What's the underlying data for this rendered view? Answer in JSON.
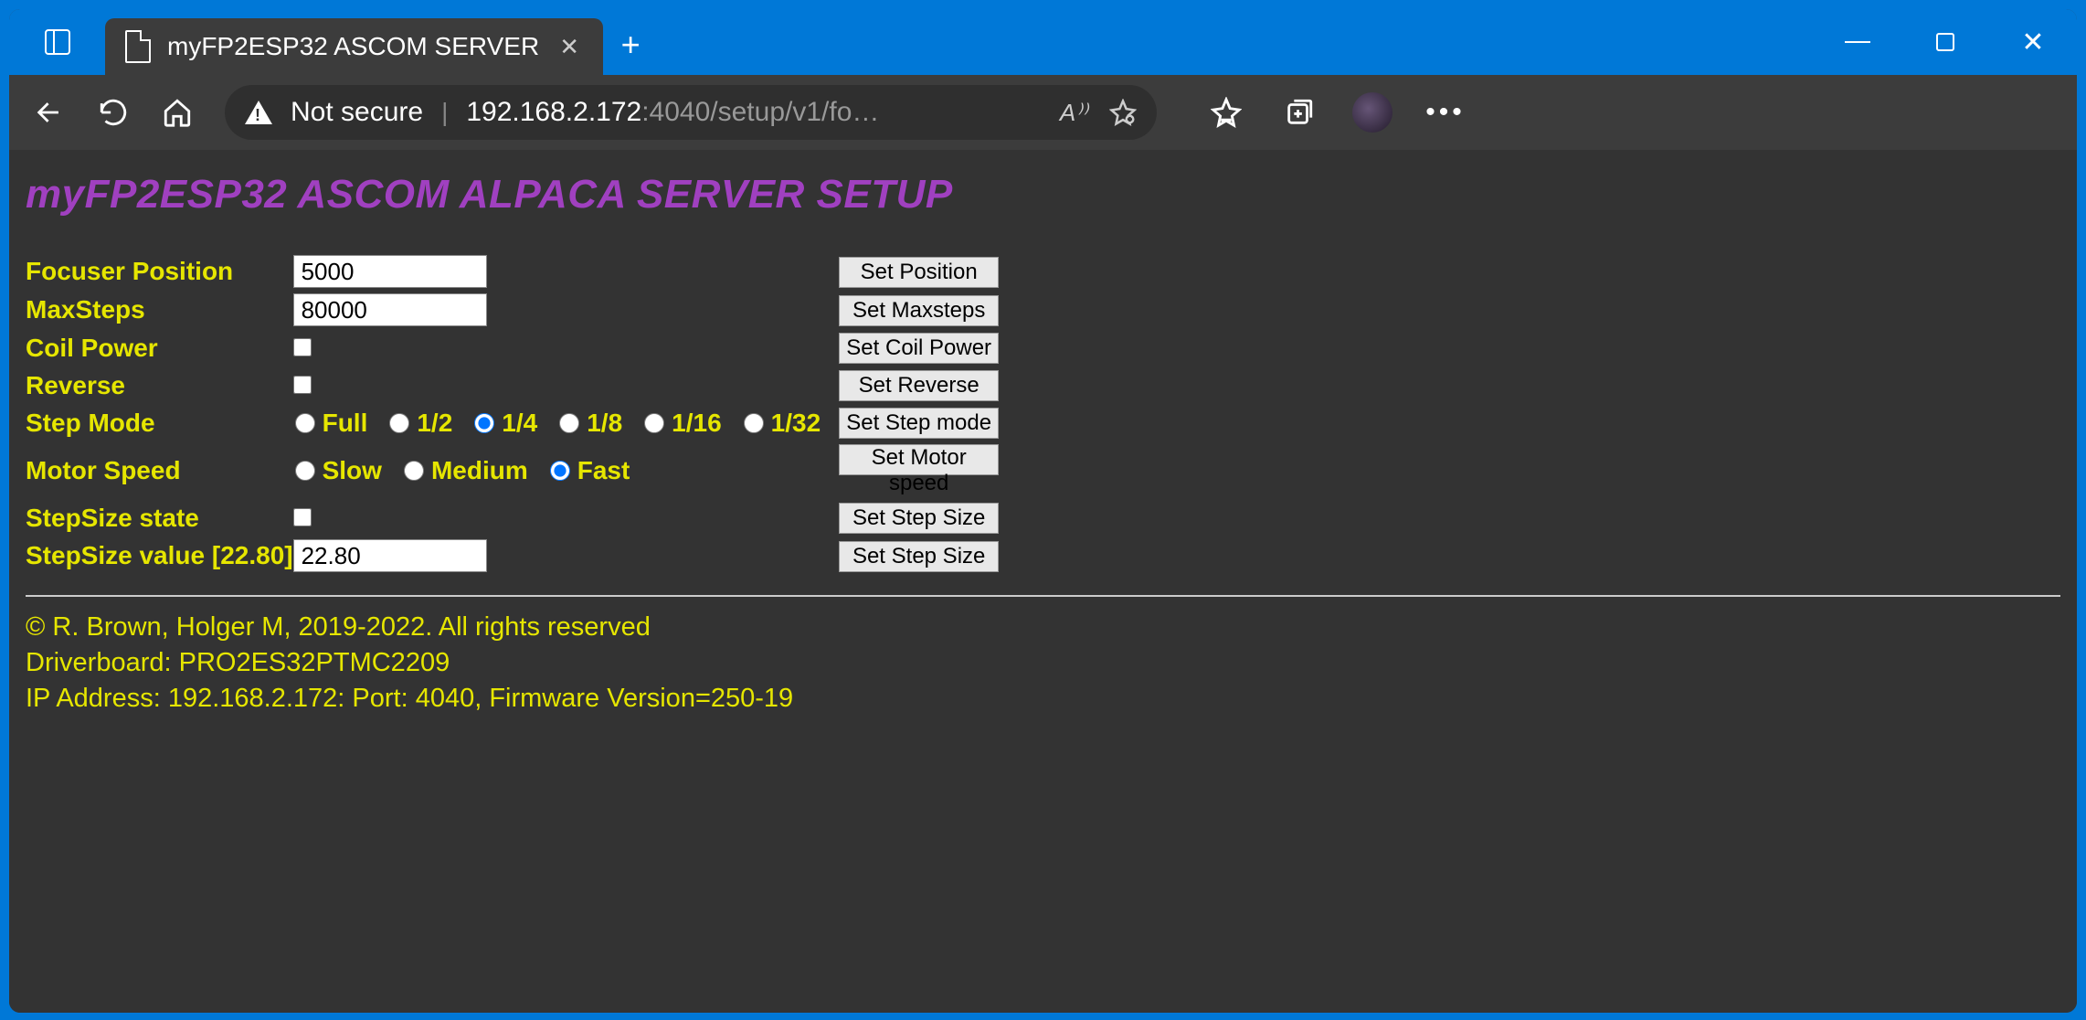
{
  "browser": {
    "tab_title": "myFP2ESP32 ASCOM SERVER",
    "not_secure_label": "Not secure",
    "url_host": "192.168.2.172",
    "url_path": ":4040/setup/v1/fo…",
    "read_aloud_label": "A⁾⁾"
  },
  "page": {
    "title": "myFP2ESP32 ASCOM ALPACA SERVER SETUP"
  },
  "form": {
    "focuser_position": {
      "label": "Focuser Position",
      "value": "5000",
      "button": "Set Position"
    },
    "max_steps": {
      "label": "MaxSteps",
      "value": "80000",
      "button": "Set Maxsteps"
    },
    "coil_power": {
      "label": "Coil Power",
      "checked": false,
      "button": "Set Coil Power"
    },
    "reverse": {
      "label": "Reverse",
      "checked": false,
      "button": "Set Reverse"
    },
    "step_mode": {
      "label": "Step Mode",
      "options": {
        "full": "Full",
        "half": "1/2",
        "quarter": "1/4",
        "eighth": "1/8",
        "sixteenth": "1/16",
        "thirtysecond": "1/32"
      },
      "selected": "quarter",
      "button": "Set Step mode"
    },
    "motor_speed": {
      "label": "Motor Speed",
      "options": {
        "slow": "Slow",
        "medium": "Medium",
        "fast": "Fast"
      },
      "selected": "fast",
      "button": "Set Motor speed"
    },
    "stepsize_state": {
      "label": "StepSize state",
      "checked": false,
      "button": "Set Step Size"
    },
    "stepsize_value": {
      "label": "StepSize value",
      "suffix": "[22.80]",
      "value": "22.80",
      "button": "Set Step Size"
    }
  },
  "footer": {
    "copyright": "© R. Brown, Holger M, 2019-2022. All rights reserved",
    "driverboard": "Driverboard: PRO2ES32PTMC2209",
    "ipline": "IP Address: 192.168.2.172: Port: 4040, Firmware Version=250-19"
  }
}
